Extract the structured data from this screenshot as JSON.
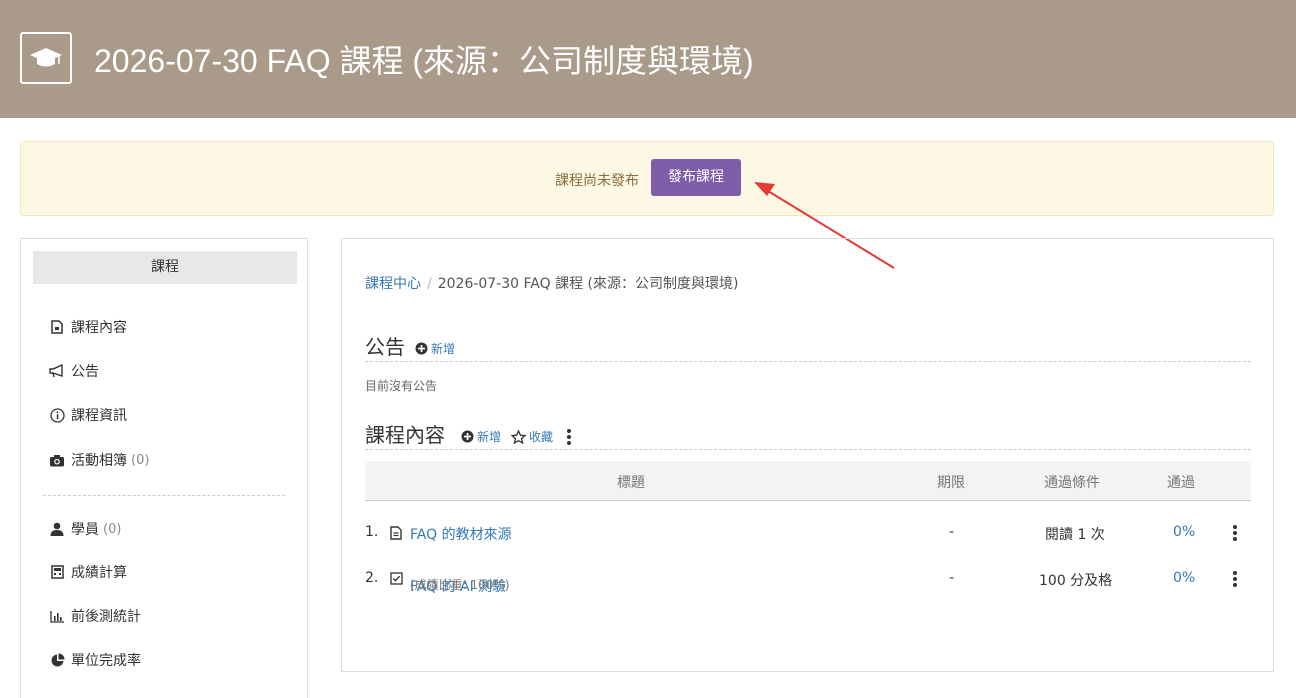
{
  "header": {
    "title": "2026-07-30 FAQ 課程 (來源：公司制度與環境)",
    "logo_icon": "graduation-cap-icon"
  },
  "notice": {
    "message": "課程尚未發布",
    "publish_label": "發布課程",
    "button_color": "#7f5da8"
  },
  "sidebar": {
    "heading": "課程",
    "items": [
      {
        "icon": "file-icon",
        "label": "課程內容",
        "count": ""
      },
      {
        "icon": "megaphone-icon",
        "label": "公告",
        "count": ""
      },
      {
        "icon": "info-icon",
        "label": "課程資訊",
        "count": ""
      },
      {
        "icon": "camera-icon",
        "label": "活動相簿",
        "count": "(0)"
      },
      {
        "icon": "user-icon",
        "label": "學員",
        "count": "(0)"
      },
      {
        "icon": "calculator-icon",
        "label": "成績計算",
        "count": ""
      },
      {
        "icon": "bar-chart-icon",
        "label": "前後測統計",
        "count": ""
      },
      {
        "icon": "pie-chart-icon",
        "label": "單位完成率",
        "count": ""
      }
    ]
  },
  "breadcrumb": {
    "home": "課程中心",
    "separator": "/",
    "current": "2026-07-30 FAQ 課程 (來源：公司制度與環境)"
  },
  "announcements": {
    "title": "公告",
    "add_label": "新增",
    "empty": "目前沒有公告"
  },
  "content": {
    "title": "課程內容",
    "add_label": "新增",
    "bookmark_label": "收藏",
    "columns": {
      "title": "標題",
      "deadline": "期限",
      "condition": "通過條件",
      "passed": "通過"
    },
    "rows": [
      {
        "index": "1.",
        "icon": "document-icon",
        "title": "FAQ 的教材來源",
        "note": "",
        "deadline": "-",
        "condition": "閱讀 1 次",
        "passed": "0%"
      },
      {
        "index": "2.",
        "icon": "checkbox-icon",
        "title": "FAQ 的 AI 測驗",
        "note": "(成績比重: 100%)",
        "deadline": "-",
        "condition": "100 分及格",
        "passed": "0%"
      }
    ]
  },
  "colors": {
    "header_bg": "#a99a8a",
    "link": "#337ab7",
    "notice_bg": "#fcf8e3",
    "arrow": "#e53935"
  }
}
